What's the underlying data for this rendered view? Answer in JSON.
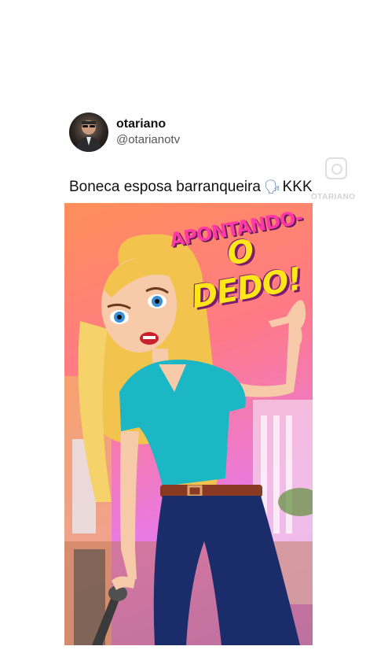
{
  "post": {
    "display_name": "otariano",
    "handle": "@otarianotv",
    "caption_text": "Boneca esposa barranqueira",
    "caption_emoji": "🗣",
    "caption_suffix": "KKK"
  },
  "media": {
    "overlay_line1": "APONTANDO-",
    "overlay_line2": "O DEDO!"
  },
  "watermark": {
    "text": "OTARIANO",
    "icon": "instagram-icon"
  },
  "colors": {
    "overlay_pink": "#ff3aa6",
    "overlay_yellow": "#ffe61a",
    "shirt": "#1bb7c4",
    "jeans": "#1a2d6a"
  }
}
